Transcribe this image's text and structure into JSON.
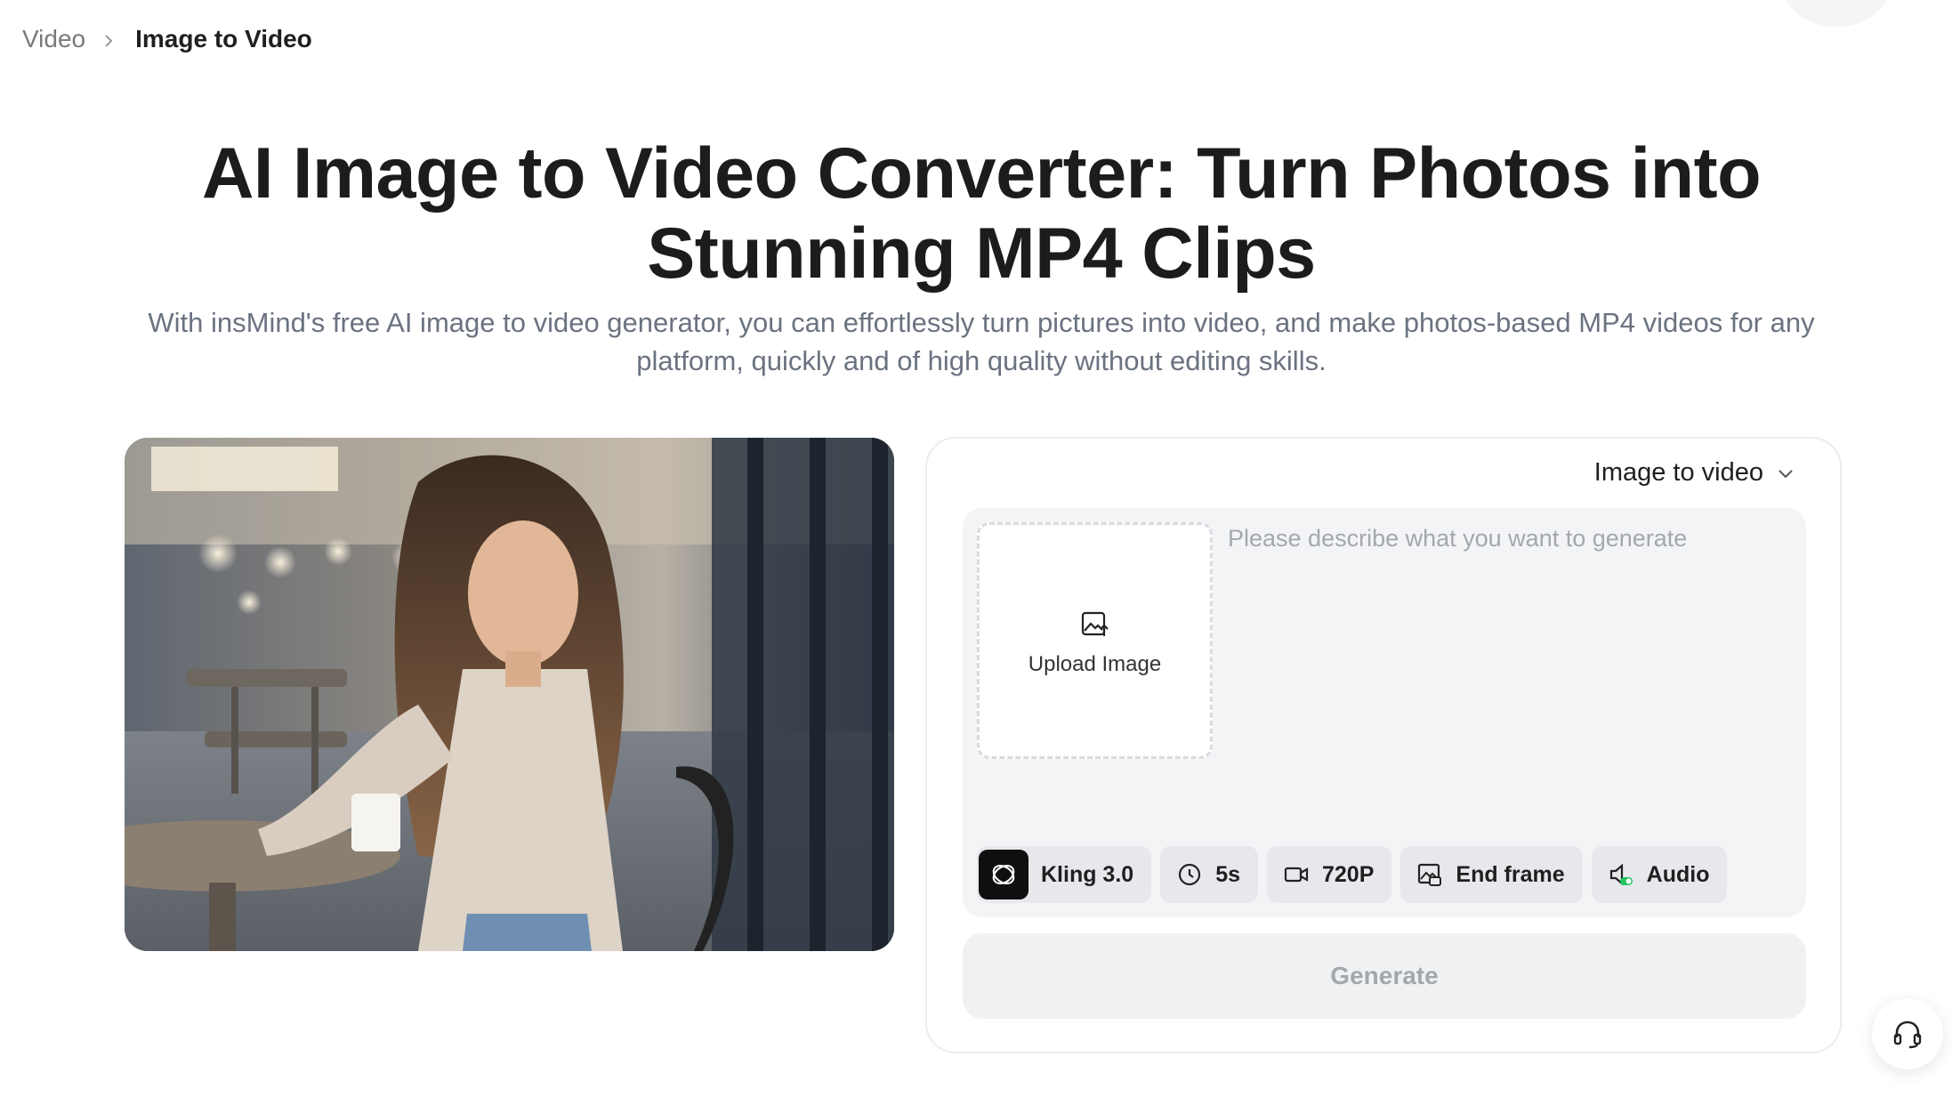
{
  "breadcrumb": {
    "parent": "Video",
    "current": "Image to Video"
  },
  "hero": {
    "title": "AI Image to Video Converter: Turn Photos into Stunning MP4 Clips",
    "subtitle": "With insMind's free AI image to video generator, you can effortlessly turn pictures into video, and make photos-based MP4 videos for any platform, quickly and of high quality without editing skills."
  },
  "panel": {
    "mode_label": "Image to video",
    "upload_label": "Upload Image",
    "prompt_placeholder": "Please describe what you want to generate",
    "prompt_value": "",
    "options": {
      "model": "Kling 3.0",
      "duration": "5s",
      "resolution": "720P",
      "end_frame": "End frame",
      "audio": "Audio"
    },
    "generate_label": "Generate"
  },
  "icons": {
    "breadcrumb_sep": "chevron-right-icon",
    "mode_select": "chevron-down-icon",
    "upload": "image-upload-icon",
    "model": "kling-logo-icon",
    "duration": "clock-icon",
    "resolution": "video-camera-icon",
    "end_frame": "end-frame-icon",
    "audio": "audio-icon",
    "support": "headset-icon"
  },
  "colors": {
    "title": "#1c1c1c",
    "subtitle": "#6b7280",
    "panel_border": "#ececee",
    "input_bg": "#f3f4f6",
    "chip_bg": "#e6e8ec",
    "generate_disabled_text": "#a4a7ae",
    "audio_accent": "#22c55e"
  }
}
